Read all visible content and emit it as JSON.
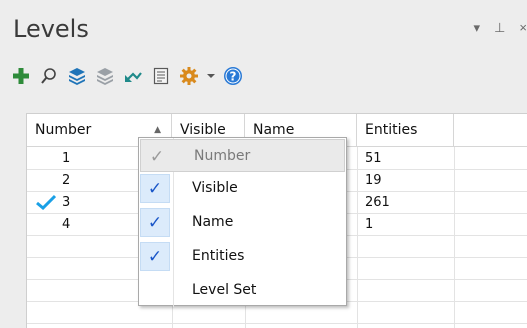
{
  "panel": {
    "title": "Levels",
    "controls": {
      "dropdown": "▾",
      "pin": "⊥",
      "close": "×"
    }
  },
  "toolbar": {
    "icons": [
      "add-icon",
      "search-icon",
      "layers-icon",
      "layers-gray-icon",
      "undo-arrow-icon",
      "document-icon",
      "gear-icon",
      "dropdown-arrow-icon",
      "help-icon"
    ],
    "colors": {
      "add": "#2e8b3a",
      "layers": "#1f74b8",
      "gear": "#d98a1d",
      "help": "#2a7ad6"
    }
  },
  "grid": {
    "columns": [
      "Number",
      "Visible",
      "Name",
      "Entities"
    ],
    "sort_indicator": "▲",
    "rows": [
      {
        "number": "1",
        "entities": "51",
        "active": false
      },
      {
        "number": "2",
        "entities": "19",
        "active": false
      },
      {
        "number": "3",
        "entities": "261",
        "active": true
      },
      {
        "number": "4",
        "entities": "1",
        "active": false
      }
    ],
    "active_check_color": "#1aa0e6"
  },
  "column_menu": {
    "items": [
      {
        "label": "Number",
        "checked": true,
        "disabled": true
      },
      {
        "label": "Visible",
        "checked": true,
        "disabled": false
      },
      {
        "label": "Name",
        "checked": true,
        "disabled": false
      },
      {
        "label": "Entities",
        "checked": true,
        "disabled": false
      },
      {
        "label": "Level Set",
        "checked": false,
        "disabled": false
      }
    ],
    "check_mark": "✓"
  }
}
